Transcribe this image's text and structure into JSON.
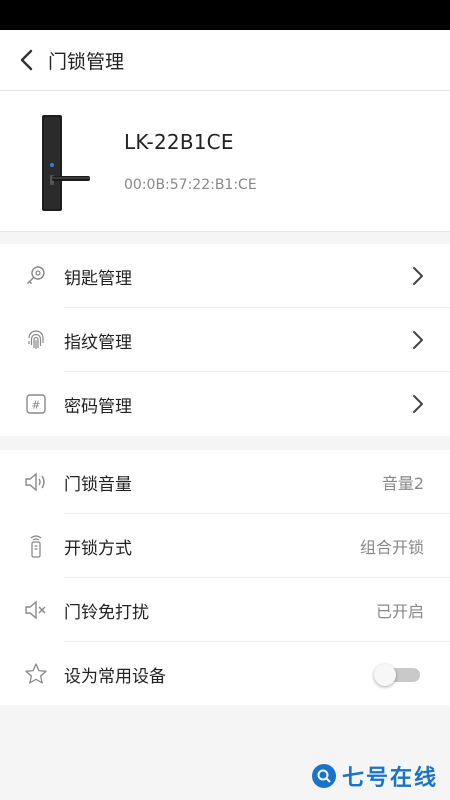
{
  "header": {
    "title": "门锁管理"
  },
  "device": {
    "name": "LK-22B1CE",
    "mac": "00:0B:57:22:B1:CE"
  },
  "management": [
    {
      "label": "钥匙管理",
      "icon": "key-icon"
    },
    {
      "label": "指纹管理",
      "icon": "fingerprint-icon"
    },
    {
      "label": "密码管理",
      "icon": "hash-icon"
    }
  ],
  "settings": [
    {
      "label": "门锁音量",
      "value": "音量2",
      "icon": "speaker-icon"
    },
    {
      "label": "开锁方式",
      "value": "组合开锁",
      "icon": "remote-icon"
    },
    {
      "label": "门铃免打扰",
      "value": "已开启",
      "icon": "mute-icon"
    },
    {
      "label": "设为常用设备",
      "toggle_on": false,
      "icon": "star-icon"
    }
  ],
  "watermark": {
    "text": "七号在线"
  },
  "colors": {
    "accent": "#1a73c8",
    "toggle_off": "#c9c9c9"
  }
}
